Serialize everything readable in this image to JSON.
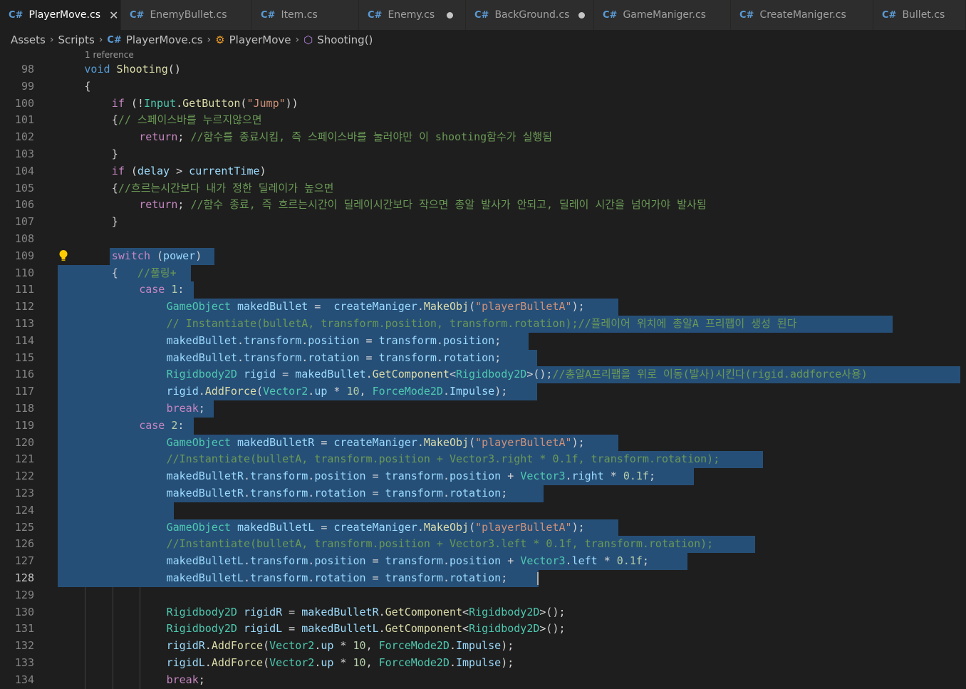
{
  "tabs": [
    {
      "label": "PlayerMove.cs",
      "active": true,
      "state": "close"
    },
    {
      "label": "EnemyBullet.cs",
      "active": false,
      "state": "none"
    },
    {
      "label": "Item.cs",
      "active": false,
      "state": "none"
    },
    {
      "label": "Enemy.cs",
      "active": false,
      "state": "dirty"
    },
    {
      "label": "BackGround.cs",
      "active": false,
      "state": "dirty"
    },
    {
      "label": "GameManiger.cs",
      "active": false,
      "state": "none"
    },
    {
      "label": "CreateManiger.cs",
      "active": false,
      "state": "none"
    },
    {
      "label": "Bullet.cs",
      "active": false,
      "state": "none"
    }
  ],
  "icons": {
    "tab_file": "csharp-file-icon",
    "close": "close-icon",
    "dirty": "unsaved-dot-icon",
    "crumb_file": "csharp-file-icon",
    "crumb_class": "class-icon",
    "crumb_method": "method-icon",
    "separator": "chevron-right-icon",
    "lightbulb": "lightbulb-icon"
  },
  "breadcrumb": [
    "Assets",
    "Scripts",
    "PlayerMove.cs",
    "PlayerMove",
    "Shooting()"
  ],
  "codelens": "1 reference",
  "colors": {
    "background": "#1e1e1e",
    "selection": "#264f78",
    "keyword": "#569cd6",
    "control": "#c586c0",
    "function": "#dcdcaa",
    "type": "#4ec9b0",
    "variable": "#9cdcfe",
    "string": "#ce9178",
    "number": "#b5cea8",
    "comment": "#6a9955"
  },
  "current_line": 128,
  "lines": [
    {
      "n": 98,
      "t": [
        [
          "kw",
          "void"
        ],
        [
          "pl",
          " "
        ],
        [
          "fn",
          "Shooting"
        ],
        [
          "pl",
          "()"
        ]
      ]
    },
    {
      "n": 99,
      "t": [
        [
          "pl",
          "{"
        ]
      ]
    },
    {
      "n": 100,
      "t": [
        [
          "ct",
          "if"
        ],
        [
          "pl",
          " (!"
        ],
        [
          "ty",
          "Input"
        ],
        [
          "pl",
          "."
        ],
        [
          "fn",
          "GetButton"
        ],
        [
          "pl",
          "("
        ],
        [
          "st",
          "\"Jump\""
        ],
        [
          "pl",
          "))"
        ]
      ]
    },
    {
      "n": 101,
      "t": [
        [
          "pl",
          "{"
        ],
        [
          "cm",
          "// 스페이스바를 누르지않으면"
        ]
      ]
    },
    {
      "n": 102,
      "t": [
        [
          "ct",
          "return"
        ],
        [
          "pl",
          "; "
        ],
        [
          "cm",
          "//함수를 종료시킴, 즉 스페이스바를 눌러야만 이 shooting함수가 실행됨"
        ]
      ]
    },
    {
      "n": 103,
      "t": [
        [
          "pl",
          "}"
        ]
      ]
    },
    {
      "n": 104,
      "t": [
        [
          "ct",
          "if"
        ],
        [
          "pl",
          " ("
        ],
        [
          "vr",
          "delay"
        ],
        [
          "pl",
          " > "
        ],
        [
          "vr",
          "currentTime"
        ],
        [
          "pl",
          ")"
        ]
      ]
    },
    {
      "n": 105,
      "t": [
        [
          "pl",
          "{"
        ],
        [
          "cm",
          "//흐르는시간보다 내가 정한 딜레이가 높으면"
        ]
      ]
    },
    {
      "n": 106,
      "t": [
        [
          "ct",
          "return"
        ],
        [
          "pl",
          "; "
        ],
        [
          "cm",
          "//함수 종료, 즉 흐르는시간이 딜레이시간보다 작으면 총알 발사가 안되고, 딜레이 시간을 넘어가야 발사됨"
        ]
      ]
    },
    {
      "n": 107,
      "t": [
        [
          "pl",
          "}"
        ]
      ]
    },
    {
      "n": 108,
      "t": []
    },
    {
      "n": 109,
      "t": [
        [
          "ct",
          "switch"
        ],
        [
          "pl",
          " ("
        ],
        [
          "vr",
          "power"
        ],
        [
          "pl",
          ")"
        ]
      ]
    },
    {
      "n": 110,
      "t": [
        [
          "pl",
          "{   "
        ],
        [
          "cm",
          "//풀링+"
        ]
      ]
    },
    {
      "n": 111,
      "t": [
        [
          "ct",
          "case"
        ],
        [
          "pl",
          " "
        ],
        [
          "nm",
          "1"
        ],
        [
          "pl",
          ":"
        ]
      ]
    },
    {
      "n": 112,
      "t": [
        [
          "ty",
          "GameObject"
        ],
        [
          "pl",
          " "
        ],
        [
          "vr",
          "makedBullet"
        ],
        [
          "pl",
          " =  "
        ],
        [
          "vr",
          "createManiger"
        ],
        [
          "pl",
          "."
        ],
        [
          "fn",
          "MakeObj"
        ],
        [
          "pl",
          "("
        ],
        [
          "st",
          "\"playerBulletA\""
        ],
        [
          "pl",
          ");"
        ]
      ]
    },
    {
      "n": 113,
      "t": [
        [
          "cm",
          "// Instantiate(bulletA, transform.position, transform.rotation);//플레이어 위치에 총알A 프리팹이 생성 된다"
        ]
      ]
    },
    {
      "n": 114,
      "t": [
        [
          "vr",
          "makedBullet"
        ],
        [
          "pl",
          "."
        ],
        [
          "vr",
          "transform"
        ],
        [
          "pl",
          "."
        ],
        [
          "vr",
          "position"
        ],
        [
          "pl",
          " = "
        ],
        [
          "vr",
          "transform"
        ],
        [
          "pl",
          "."
        ],
        [
          "vr",
          "position"
        ],
        [
          "pl",
          ";"
        ]
      ]
    },
    {
      "n": 115,
      "t": [
        [
          "vr",
          "makedBullet"
        ],
        [
          "pl",
          "."
        ],
        [
          "vr",
          "transform"
        ],
        [
          "pl",
          "."
        ],
        [
          "vr",
          "rotation"
        ],
        [
          "pl",
          " = "
        ],
        [
          "vr",
          "transform"
        ],
        [
          "pl",
          "."
        ],
        [
          "vr",
          "rotation"
        ],
        [
          "pl",
          ";"
        ]
      ]
    },
    {
      "n": 116,
      "t": [
        [
          "ty",
          "Rigidbody2D"
        ],
        [
          "pl",
          " "
        ],
        [
          "vr",
          "rigid"
        ],
        [
          "pl",
          " = "
        ],
        [
          "vr",
          "makedBullet"
        ],
        [
          "pl",
          "."
        ],
        [
          "fn",
          "GetComponent"
        ],
        [
          "pl",
          "<"
        ],
        [
          "ty",
          "Rigidbody2D"
        ],
        [
          "pl",
          ">();"
        ],
        [
          "cm",
          "//총알A프리팹을 위로 이동(발사)시킨다(rigid.addforce사용)"
        ]
      ]
    },
    {
      "n": 117,
      "t": [
        [
          "vr",
          "rigid"
        ],
        [
          "pl",
          "."
        ],
        [
          "fn",
          "AddForce"
        ],
        [
          "pl",
          "("
        ],
        [
          "ty",
          "Vector2"
        ],
        [
          "pl",
          "."
        ],
        [
          "vr",
          "up"
        ],
        [
          "pl",
          " * "
        ],
        [
          "nm",
          "10"
        ],
        [
          "pl",
          ", "
        ],
        [
          "ty",
          "ForceMode2D"
        ],
        [
          "pl",
          "."
        ],
        [
          "vr",
          "Impulse"
        ],
        [
          "pl",
          ");"
        ]
      ]
    },
    {
      "n": 118,
      "t": [
        [
          "ct",
          "break"
        ],
        [
          "pl",
          ";"
        ]
      ]
    },
    {
      "n": 119,
      "t": [
        [
          "ct",
          "case"
        ],
        [
          "pl",
          " "
        ],
        [
          "nm",
          "2"
        ],
        [
          "pl",
          ":"
        ]
      ]
    },
    {
      "n": 120,
      "t": [
        [
          "ty",
          "GameObject"
        ],
        [
          "pl",
          " "
        ],
        [
          "vr",
          "makedBulletR"
        ],
        [
          "pl",
          " = "
        ],
        [
          "vr",
          "createManiger"
        ],
        [
          "pl",
          "."
        ],
        [
          "fn",
          "MakeObj"
        ],
        [
          "pl",
          "("
        ],
        [
          "st",
          "\"playerBulletA\""
        ],
        [
          "pl",
          ");"
        ]
      ]
    },
    {
      "n": 121,
      "t": [
        [
          "cm",
          "//Instantiate(bulletA, transform.position + Vector3.right * 0.1f, transform.rotation);"
        ]
      ]
    },
    {
      "n": 122,
      "t": [
        [
          "vr",
          "makedBulletR"
        ],
        [
          "pl",
          "."
        ],
        [
          "vr",
          "transform"
        ],
        [
          "pl",
          "."
        ],
        [
          "vr",
          "position"
        ],
        [
          "pl",
          " = "
        ],
        [
          "vr",
          "transform"
        ],
        [
          "pl",
          "."
        ],
        [
          "vr",
          "position"
        ],
        [
          "pl",
          " + "
        ],
        [
          "ty",
          "Vector3"
        ],
        [
          "pl",
          "."
        ],
        [
          "vr",
          "right"
        ],
        [
          "pl",
          " * "
        ],
        [
          "nm",
          "0.1f"
        ],
        [
          "pl",
          ";"
        ]
      ]
    },
    {
      "n": 123,
      "t": [
        [
          "vr",
          "makedBulletR"
        ],
        [
          "pl",
          "."
        ],
        [
          "vr",
          "transform"
        ],
        [
          "pl",
          "."
        ],
        [
          "vr",
          "rotation"
        ],
        [
          "pl",
          " = "
        ],
        [
          "vr",
          "transform"
        ],
        [
          "pl",
          "."
        ],
        [
          "vr",
          "rotation"
        ],
        [
          "pl",
          ";"
        ]
      ]
    },
    {
      "n": 124,
      "t": []
    },
    {
      "n": 125,
      "t": [
        [
          "ty",
          "GameObject"
        ],
        [
          "pl",
          " "
        ],
        [
          "vr",
          "makedBulletL"
        ],
        [
          "pl",
          " = "
        ],
        [
          "vr",
          "createManiger"
        ],
        [
          "pl",
          "."
        ],
        [
          "fn",
          "MakeObj"
        ],
        [
          "pl",
          "("
        ],
        [
          "st",
          "\"playerBulletA\""
        ],
        [
          "pl",
          ");"
        ]
      ]
    },
    {
      "n": 126,
      "t": [
        [
          "cm",
          "//Instantiate(bulletA, transform.position + Vector3.left * 0.1f, transform.rotation);"
        ]
      ]
    },
    {
      "n": 127,
      "t": [
        [
          "vr",
          "makedBulletL"
        ],
        [
          "pl",
          "."
        ],
        [
          "vr",
          "transform"
        ],
        [
          "pl",
          "."
        ],
        [
          "vr",
          "position"
        ],
        [
          "pl",
          " = "
        ],
        [
          "vr",
          "transform"
        ],
        [
          "pl",
          "."
        ],
        [
          "vr",
          "position"
        ],
        [
          "pl",
          " + "
        ],
        [
          "ty",
          "Vector3"
        ],
        [
          "pl",
          "."
        ],
        [
          "vr",
          "left"
        ],
        [
          "pl",
          " * "
        ],
        [
          "nm",
          "0.1f"
        ],
        [
          "pl",
          ";"
        ]
      ]
    },
    {
      "n": 128,
      "t": [
        [
          "vr",
          "makedBulletL"
        ],
        [
          "pl",
          "."
        ],
        [
          "vr",
          "transform"
        ],
        [
          "pl",
          "."
        ],
        [
          "vr",
          "rotation"
        ],
        [
          "pl",
          " = "
        ],
        [
          "vr",
          "transform"
        ],
        [
          "pl",
          "."
        ],
        [
          "vr",
          "rotation"
        ],
        [
          "pl",
          ";"
        ]
      ]
    },
    {
      "n": 129,
      "t": []
    },
    {
      "n": 130,
      "t": [
        [
          "ty",
          "Rigidbody2D"
        ],
        [
          "pl",
          " "
        ],
        [
          "vr",
          "rigidR"
        ],
        [
          "pl",
          " = "
        ],
        [
          "vr",
          "makedBulletR"
        ],
        [
          "pl",
          "."
        ],
        [
          "fn",
          "GetComponent"
        ],
        [
          "pl",
          "<"
        ],
        [
          "ty",
          "Rigidbody2D"
        ],
        [
          "pl",
          ">();"
        ]
      ]
    },
    {
      "n": 131,
      "t": [
        [
          "ty",
          "Rigidbody2D"
        ],
        [
          "pl",
          " "
        ],
        [
          "vr",
          "rigidL"
        ],
        [
          "pl",
          " = "
        ],
        [
          "vr",
          "makedBulletL"
        ],
        [
          "pl",
          "."
        ],
        [
          "fn",
          "GetComponent"
        ],
        [
          "pl",
          "<"
        ],
        [
          "ty",
          "Rigidbody2D"
        ],
        [
          "pl",
          ">();"
        ]
      ]
    },
    {
      "n": 132,
      "t": [
        [
          "vr",
          "rigidR"
        ],
        [
          "pl",
          "."
        ],
        [
          "fn",
          "AddForce"
        ],
        [
          "pl",
          "("
        ],
        [
          "ty",
          "Vector2"
        ],
        [
          "pl",
          "."
        ],
        [
          "vr",
          "up"
        ],
        [
          "pl",
          " * "
        ],
        [
          "nm",
          "10"
        ],
        [
          "pl",
          ", "
        ],
        [
          "ty",
          "ForceMode2D"
        ],
        [
          "pl",
          "."
        ],
        [
          "vr",
          "Impulse"
        ],
        [
          "pl",
          ");"
        ]
      ]
    },
    {
      "n": 133,
      "t": [
        [
          "vr",
          "rigidL"
        ],
        [
          "pl",
          "."
        ],
        [
          "fn",
          "AddForce"
        ],
        [
          "pl",
          "("
        ],
        [
          "ty",
          "Vector2"
        ],
        [
          "pl",
          "."
        ],
        [
          "vr",
          "up"
        ],
        [
          "pl",
          " * "
        ],
        [
          "nm",
          "10"
        ],
        [
          "pl",
          ", "
        ],
        [
          "ty",
          "ForceMode2D"
        ],
        [
          "pl",
          "."
        ],
        [
          "vr",
          "Impulse"
        ],
        [
          "pl",
          ");"
        ]
      ]
    },
    {
      "n": 134,
      "t": [
        [
          "ct",
          "break"
        ],
        [
          "pl",
          ";"
        ]
      ]
    }
  ]
}
